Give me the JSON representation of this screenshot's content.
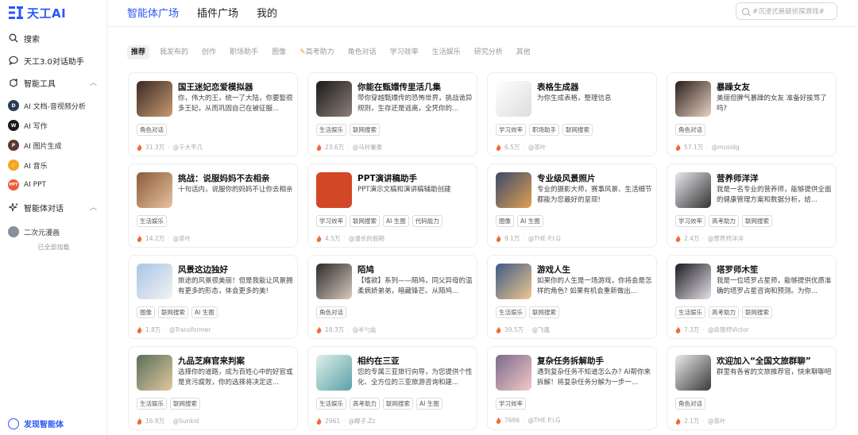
{
  "brand": {
    "name": "天工AI",
    "color": "#2b57f5"
  },
  "sidebar": {
    "search": "搜索",
    "chat": "天工3.0对话助手",
    "tools": "智能工具",
    "tool_items": [
      {
        "label": "AI 文档-音视频分析",
        "color": "#2a3b55",
        "glyph": "D"
      },
      {
        "label": "AI 写作",
        "color": "#1a1a1a",
        "glyph": "W"
      },
      {
        "label": "AI 图片生成",
        "color": "#5a3b2e",
        "glyph": "P"
      },
      {
        "label": "AI 音乐",
        "color": "#f5a623",
        "glyph": "♪"
      },
      {
        "label": "AI PPT",
        "color": "#f05a3a",
        "glyph": "PPT"
      }
    ],
    "agents": "智能体对话",
    "agent_items": [
      {
        "label": "二次元漫画",
        "color": "#8a8f9c",
        "glyph": ""
      }
    ],
    "loaded_note": "已全部加载",
    "discover": "发现智能体"
  },
  "topbar": {
    "tabs": [
      "智能体广场",
      "插件广场",
      "我的"
    ],
    "search_placeholder": "#沉浸式悬疑侦探游戏#"
  },
  "categories": [
    "推荐",
    "我发布的",
    "创作",
    "职场助手",
    "图像",
    "高考助力",
    "角色对话",
    "学习效率",
    "生活娱乐",
    "研究分析",
    "其他"
  ],
  "cards": [
    {
      "title": "国王迷妃恋爱模拟器",
      "desc": "你，伟大的王，统一了大陆，你要娶很多王妃，从而巩固自己在被征服...",
      "tags": [
        "角色对话"
      ],
      "count": "31.3万",
      "author": "@千大平几",
      "thumb": [
        "#3a2a22",
        "#c89a72"
      ]
    },
    {
      "title": "你能在甄嬛传里活几集",
      "desc": "带你穿越甄嬛传的恐怖世界，挑战诡异规则，生存还是逃离，全凭你的...",
      "tags": [
        "生活娱乐",
        "联网搜索"
      ],
      "count": "23.6万",
      "author": "@马铃薯泰",
      "thumb": [
        "#1a1a1a",
        "#8d7f78"
      ]
    },
    {
      "title": "表格生成器",
      "desc": "为你生成表格，整理信息",
      "tags": [
        "学习效率",
        "职场助手",
        "联网搜索"
      ],
      "count": "6.5万",
      "author": "@茶叶",
      "thumb": [
        "#ffffff",
        "#dddddd"
      ]
    },
    {
      "title": "暴躁女友",
      "desc": "美丽但脾气暴躁的女友 准备好挨骂了吗?",
      "tags": [
        "角色对话"
      ],
      "count": "57.1万",
      "author": "@musidg",
      "thumb": [
        "#2a1e1a",
        "#e8d2c4"
      ]
    },
    {
      "title": "挑战：说服妈妈不去相亲",
      "desc": "十句话内，说服你的妈妈不让你去相亲",
      "tags": [
        "生活娱乐"
      ],
      "count": "14.2万",
      "author": "@茶叶",
      "thumb": [
        "#8a5a3a",
        "#e7c2a0"
      ]
    },
    {
      "title": "PPT演讲稿助手",
      "desc": "PPT演示文稿和演讲稿辅助创建",
      "tags": [
        "学习效率",
        "联网搜索",
        "AI 生图",
        "代码能力"
      ],
      "count": "4.5万",
      "author": "@漫长的假期",
      "thumb": [
        "#d24726",
        "#d24726"
      ]
    },
    {
      "title": "专业级风景照片",
      "desc": "专业的摄影大师，赛事风景、生活细节都能为您最好的呈现!",
      "tags": [
        "图像",
        "AI 生图"
      ],
      "count": "9.1万",
      "author": "@THE P.I.G",
      "thumb": [
        "#3b4a6b",
        "#e0a050"
      ]
    },
    {
      "title": "营养师洋洋",
      "desc": "我是一名专业的营养师，能够提供全面的健康管理方案和数据分析，给...",
      "tags": [
        "学习效率",
        "高考助力",
        "联网搜索"
      ],
      "count": "2.4万",
      "author": "@营养师洋洋",
      "thumb": [
        "#e8eaee",
        "#333333"
      ]
    },
    {
      "title": "风景这边独好",
      "desc": "旅途的风景很美丽！但是我能让风景拥有更多的形态，体会更多的美!",
      "tags": [
        "图像",
        "联网搜索",
        "AI 生图"
      ],
      "count": "1.8万",
      "author": "@Transformer",
      "thumb": [
        "#a9c6e6",
        "#f2f2f2"
      ]
    },
    {
      "title": "陌鸠",
      "desc": "【嗜欲】系列——陌鸠，同父异母的温柔病娇弟弟，暗藏锋芒。从陌鸠...",
      "tags": [
        "角色对话"
      ],
      "count": "18.3万",
      "author": "@半勺盐",
      "thumb": [
        "#2b2b2b",
        "#d9c9bc"
      ]
    },
    {
      "title": "游戏人生",
      "desc": "如果你的人生是一场游戏，你将会是怎样的角色? 如果有机会重新做出...",
      "tags": [
        "生活娱乐",
        "联网搜索"
      ],
      "count": "39.5万",
      "author": "@飞凰",
      "thumb": [
        "#3c5a85",
        "#f0c890"
      ]
    },
    {
      "title": "塔罗师木笙",
      "desc": "我是一位塔罗占星师，能够提供优质准确的塔罗占星咨询和预测。为你...",
      "tags": [
        "生活娱乐",
        "高考助力",
        "联网搜索"
      ],
      "count": "7.3万",
      "author": "@命理师Victor",
      "thumb": [
        "#1c1c22",
        "#e6e0e8"
      ]
    },
    {
      "title": "九品芝麻官来判案",
      "desc": "选择你的道路，成为百姓心中的好官或是贪污腐败，你的选择将决定这...",
      "tags": [
        "生活娱乐",
        "联网搜索"
      ],
      "count": "16.8万",
      "author": "@Sunkid",
      "thumb": [
        "#5a6e58",
        "#e0c8a0"
      ]
    },
    {
      "title": "相约在三亚",
      "desc": "您的专属三亚旅行向导，为您提供个性化、全方位的三亚旅游咨询和建...",
      "tags": [
        "生活娱乐",
        "高考助力",
        "联网搜索",
        "AI 生图"
      ],
      "count": "2961",
      "author": "@椰子.Zz",
      "thumb": [
        "#dff0e8",
        "#5aa0a8"
      ]
    },
    {
      "title": "复杂任务拆解助手",
      "desc": "遇到复杂任务不知道怎么办? AI帮你来拆解！将复杂任务分解为一步一...",
      "tags": [
        "学习效率"
      ],
      "count": "7686",
      "author": "@THE P.I.G",
      "thumb": [
        "#7a6a8a",
        "#f3c9c9"
      ]
    },
    {
      "title": "欢迎加入“全国文旅群聊”",
      "desc": "群里有各省的文旅推荐官，快来聊聊吧",
      "tags": [
        "角色对话"
      ],
      "count": "2.1万",
      "author": "@茶叶",
      "thumb": [
        "#ebebeb",
        "#3a3a3a"
      ]
    }
  ]
}
